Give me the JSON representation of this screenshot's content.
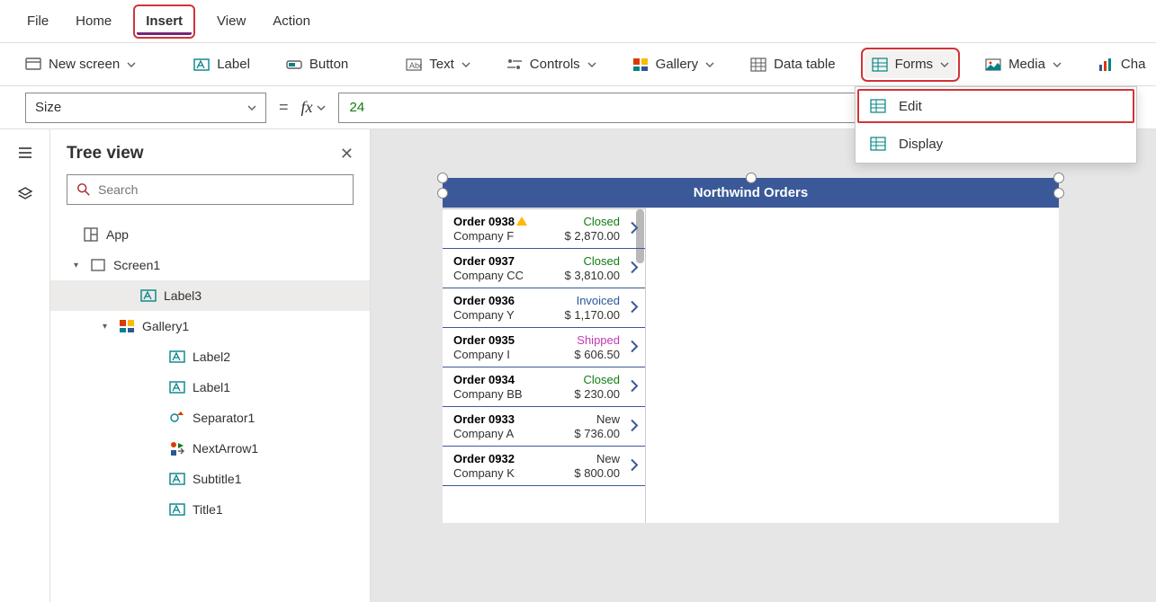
{
  "menubar": {
    "file": "File",
    "home": "Home",
    "insert": "Insert",
    "view": "View",
    "action": "Action"
  },
  "ribbon": {
    "new_screen": "New screen",
    "label": "Label",
    "button": "Button",
    "text": "Text",
    "controls": "Controls",
    "gallery": "Gallery",
    "data_table": "Data table",
    "forms": "Forms",
    "media": "Media",
    "chart": "Cha"
  },
  "forms_menu": {
    "edit": "Edit",
    "display": "Display"
  },
  "formula": {
    "property": "Size",
    "value": "24"
  },
  "tree": {
    "title": "Tree view",
    "search_placeholder": "Search",
    "app": "App",
    "screen1": "Screen1",
    "label3": "Label3",
    "gallery1": "Gallery1",
    "label2": "Label2",
    "label1": "Label1",
    "separator1": "Separator1",
    "nextarrow1": "NextArrow1",
    "subtitle1": "Subtitle1",
    "title1": "Title1"
  },
  "canvas": {
    "title": "Northwind Orders",
    "rows": [
      {
        "order": "Order 0938",
        "company": "Company F",
        "status": "Closed",
        "status_cls": "st-closed",
        "amount": "$ 2,870.00",
        "warn": true
      },
      {
        "order": "Order 0937",
        "company": "Company CC",
        "status": "Closed",
        "status_cls": "st-closed",
        "amount": "$ 3,810.00",
        "warn": false
      },
      {
        "order": "Order 0936",
        "company": "Company Y",
        "status": "Invoiced",
        "status_cls": "st-invoiced",
        "amount": "$ 1,170.00",
        "warn": false
      },
      {
        "order": "Order 0935",
        "company": "Company I",
        "status": "Shipped",
        "status_cls": "st-shipped",
        "amount": "$ 606.50",
        "warn": false
      },
      {
        "order": "Order 0934",
        "company": "Company BB",
        "status": "Closed",
        "status_cls": "st-closed",
        "amount": "$ 230.00",
        "warn": false
      },
      {
        "order": "Order 0933",
        "company": "Company A",
        "status": "New",
        "status_cls": "st-new",
        "amount": "$ 736.00",
        "warn": false
      },
      {
        "order": "Order 0932",
        "company": "Company K",
        "status": "New",
        "status_cls": "st-new",
        "amount": "$ 800.00",
        "warn": false
      }
    ]
  }
}
